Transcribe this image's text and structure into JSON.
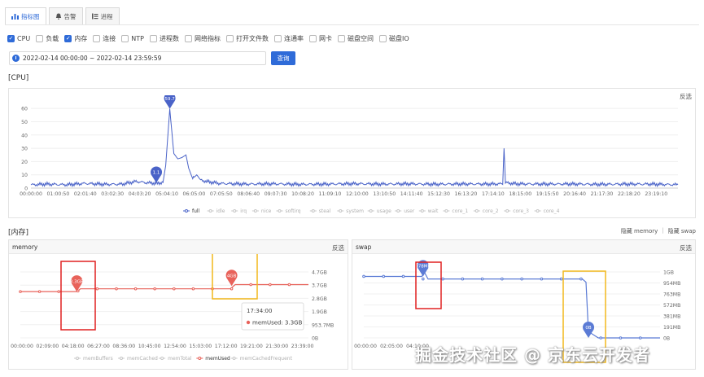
{
  "tabs": [
    {
      "label": "指标图",
      "icon": "chart-icon",
      "active": true
    },
    {
      "label": "告警",
      "icon": "bell-icon",
      "active": false
    },
    {
      "label": "进程",
      "icon": "list-icon",
      "active": false
    }
  ],
  "metrics": [
    {
      "label": "CPU",
      "checked": true
    },
    {
      "label": "负载",
      "checked": false
    },
    {
      "label": "内存",
      "checked": true
    },
    {
      "label": "连接",
      "checked": false
    },
    {
      "label": "NTP",
      "checked": false
    },
    {
      "label": "进程数",
      "checked": false
    },
    {
      "label": "网络指标",
      "checked": false
    },
    {
      "label": "打开文件数",
      "checked": false
    },
    {
      "label": "连通率",
      "checked": false
    },
    {
      "label": "网卡",
      "checked": false
    },
    {
      "label": "磁盘空间",
      "checked": false
    },
    {
      "label": "磁盘IO",
      "checked": false
    }
  ],
  "date_range": "2022-02-14 00:00:00  ~  2022-02-14 23:59:59",
  "query_label": "查询",
  "sections": {
    "cpu": "[CPU]",
    "mem": "[内存]"
  },
  "invert_label": "反选",
  "mem_toggles": {
    "hide_memory": "隐藏 memory",
    "separator": "|",
    "hide_swap": "隐藏 swap"
  },
  "panels": {
    "memory": "memory",
    "swap": "swap"
  },
  "watermark": "掘金技术社区 @ 京东云开发者",
  "colors": {
    "accent": "#2f6bd8",
    "cpu_line": "#4a63c8",
    "mem_line": "#e8625a",
    "swap_line": "#5b7bd5",
    "highlight": "#f2b81c",
    "box_red": "#e02020"
  },
  "chart_data": [
    {
      "type": "line",
      "name": "cpu",
      "x_ticks": [
        "00:00:00",
        "01:00:50",
        "02:01:40",
        "03:02:30",
        "04:03:20",
        "05:04:10",
        "06:05:00",
        "07:05:50",
        "08:06:40",
        "09:07:30",
        "10:08:20",
        "11:09:10",
        "12:10:00",
        "13:10:50",
        "14:11:40",
        "15:12:30",
        "16:13:20",
        "17:14:10",
        "18:15:00",
        "19:15:50",
        "20:16:40",
        "21:17:30",
        "22:18:20",
        "23:19:10"
      ],
      "y_ticks": [
        0,
        10,
        20,
        30,
        40,
        50,
        60
      ],
      "ylim": [
        0,
        65
      ],
      "xlim_hours": [
        0,
        24
      ],
      "series": [
        {
          "name": "full",
          "x_hours": [
            0,
            0.6,
            1.3,
            2,
            2.8,
            3.4,
            3.9,
            4.3,
            4.7,
            4.9,
            5.0,
            5.15,
            5.3,
            5.45,
            5.6,
            5.75,
            5.85,
            6,
            6.15,
            6.3,
            6.5,
            7,
            8,
            9,
            10,
            11,
            12,
            13,
            14,
            15,
            16,
            17,
            17.5,
            17.55,
            17.6,
            18,
            19,
            20,
            21,
            22,
            23,
            24
          ],
          "values": [
            2.5,
            3,
            2.5,
            3.5,
            2.8,
            3,
            5,
            4,
            3.5,
            4.5,
            17,
            59.7,
            26,
            22,
            23,
            25,
            15,
            7,
            10,
            6,
            5,
            3.5,
            3,
            3.2,
            2.8,
            3,
            3.3,
            3,
            3.2,
            2.9,
            3.1,
            3,
            3.2,
            30,
            4,
            3.2,
            3,
            3.1,
            2.8,
            3,
            3,
            2.5
          ]
        }
      ],
      "legend": [
        "full",
        "idle",
        "irq",
        "nice",
        "softirq",
        "steal",
        "system",
        "usage",
        "user",
        "wait",
        "core_1",
        "core_2",
        "core_3",
        "core_4"
      ],
      "annotations": [
        {
          "label": "59.7",
          "x_hours": 5.15,
          "y": 59.7
        },
        {
          "label": "1.1",
          "x_hours": 4.65,
          "y": 4
        }
      ]
    },
    {
      "type": "line",
      "name": "memory",
      "x_ticks": [
        "00:00:00",
        "02:09:00",
        "04:18:00",
        "06:27:00",
        "08:36:00",
        "10:45:00",
        "12:54:00",
        "15:03:00",
        "17:12:00",
        "19:21:00",
        "21:30:00",
        "23:39:00"
      ],
      "y_ticks": [
        "0B",
        "953.7MB",
        "1.9GB",
        "2.8GB",
        "3.7GB",
        "4.7GB"
      ],
      "ylim_gb": [
        0,
        4.7
      ],
      "xlim_hours": [
        0,
        24
      ],
      "series": [
        {
          "name": "memUsed",
          "x_hours": [
            0,
            4.7,
            4.8,
            5.0,
            17.2,
            17.5,
            17.9,
            18.0,
            24
          ],
          "values": [
            3.3,
            3.3,
            3.35,
            3.5,
            3.5,
            3.5,
            3.8,
            3.8,
            3.8
          ]
        }
      ],
      "legend": [
        "memBuffers",
        "memCached",
        "memTotal",
        "memUsed",
        "memCachedFrequent"
      ],
      "annotations": [
        {
          "label": "3.3GB",
          "x_hours": 4.7,
          "y": 3.3
        },
        {
          "label": "4GB",
          "x_hours": 17.6,
          "y": 3.7
        }
      ],
      "tooltip": {
        "time": "17:34:00",
        "text": "memUsed: 3.3GB"
      }
    },
    {
      "type": "line",
      "name": "swap",
      "x_ticks": [
        "00:00:00",
        "02:05:00",
        "04:10:00"
      ],
      "y_ticks": [
        "0B",
        "191MB",
        "381MB",
        "572MB",
        "763MB",
        "954MB",
        "1GB"
      ],
      "ylim_mb": [
        0,
        1040
      ],
      "xlim_hours": [
        0,
        24
      ],
      "series": [
        {
          "name": "swap",
          "x_hours": [
            0,
            4.7,
            4.9,
            5.2,
            17.7,
            18.0,
            18.2,
            19.0,
            24
          ],
          "values": [
            970,
            970,
            1040,
            930,
            930,
            880,
            100,
            0,
            0
          ]
        }
      ],
      "annotations": [
        {
          "label": "978MB",
          "x_hours": 4.8,
          "y": 970
        },
        {
          "label": "0B",
          "x_hours": 18.2,
          "y": 0
        }
      ]
    }
  ]
}
